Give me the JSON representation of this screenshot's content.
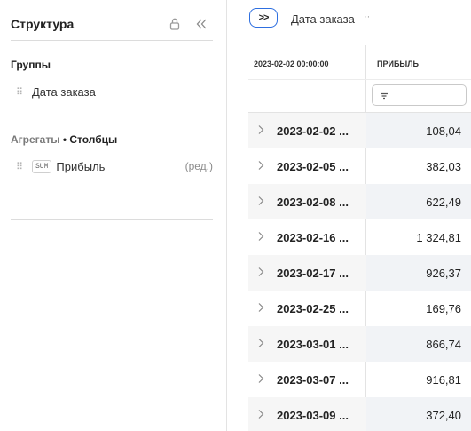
{
  "structure_panel": {
    "title": "Структура",
    "icons": {
      "lock": "lock-icon",
      "collapse": "double-chevron-left-icon"
    }
  },
  "groups": {
    "title": "Группы",
    "items": [
      {
        "label": "Дата заказа"
      }
    ]
  },
  "aggregates": {
    "title_prefix": "Агрегаты",
    "title_separator": "•",
    "title_suffix": "Столбцы",
    "items": [
      {
        "badge": "SUM",
        "label": "Прибыль",
        "edit": "(ред.)"
      }
    ]
  },
  "toolbar": {
    "toggle_label": ">>",
    "group_chip_label": "Дата заказа",
    "chip_menu": "··"
  },
  "table": {
    "columns": [
      "2023-02-02 00:00:00",
      "ПРИБЫЛЬ"
    ],
    "rows": [
      {
        "date": "2023-02-02 ...",
        "value": "108,04"
      },
      {
        "date": "2023-02-05 ...",
        "value": "382,03"
      },
      {
        "date": "2023-02-08 ...",
        "value": "622,49"
      },
      {
        "date": "2023-02-16 ...",
        "value": "1 324,81"
      },
      {
        "date": "2023-02-17 ...",
        "value": "926,37"
      },
      {
        "date": "2023-02-25 ...",
        "value": "169,76"
      },
      {
        "date": "2023-03-01 ...",
        "value": "866,74"
      },
      {
        "date": "2023-03-07 ...",
        "value": "916,81"
      },
      {
        "date": "2023-03-09 ...",
        "value": "372,40"
      }
    ]
  },
  "colors": {
    "accent": "#2e6fe0",
    "row_alt": "#f6f6f6",
    "border": "#e3e3e3"
  }
}
